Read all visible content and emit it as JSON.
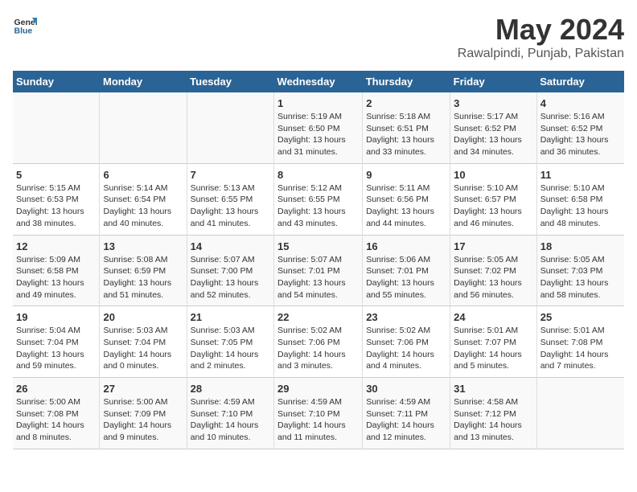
{
  "header": {
    "logo_general": "General",
    "logo_blue": "Blue",
    "title": "May 2024",
    "subtitle": "Rawalpindi, Punjab, Pakistan"
  },
  "days_of_week": [
    "Sunday",
    "Monday",
    "Tuesday",
    "Wednesday",
    "Thursday",
    "Friday",
    "Saturday"
  ],
  "weeks": [
    {
      "days": [
        {
          "num": "",
          "text": ""
        },
        {
          "num": "",
          "text": ""
        },
        {
          "num": "",
          "text": ""
        },
        {
          "num": "1",
          "text": "Sunrise: 5:19 AM\nSunset: 6:50 PM\nDaylight: 13 hours and 31 minutes."
        },
        {
          "num": "2",
          "text": "Sunrise: 5:18 AM\nSunset: 6:51 PM\nDaylight: 13 hours and 33 minutes."
        },
        {
          "num": "3",
          "text": "Sunrise: 5:17 AM\nSunset: 6:52 PM\nDaylight: 13 hours and 34 minutes."
        },
        {
          "num": "4",
          "text": "Sunrise: 5:16 AM\nSunset: 6:52 PM\nDaylight: 13 hours and 36 minutes."
        }
      ]
    },
    {
      "days": [
        {
          "num": "5",
          "text": "Sunrise: 5:15 AM\nSunset: 6:53 PM\nDaylight: 13 hours and 38 minutes."
        },
        {
          "num": "6",
          "text": "Sunrise: 5:14 AM\nSunset: 6:54 PM\nDaylight: 13 hours and 40 minutes."
        },
        {
          "num": "7",
          "text": "Sunrise: 5:13 AM\nSunset: 6:55 PM\nDaylight: 13 hours and 41 minutes."
        },
        {
          "num": "8",
          "text": "Sunrise: 5:12 AM\nSunset: 6:55 PM\nDaylight: 13 hours and 43 minutes."
        },
        {
          "num": "9",
          "text": "Sunrise: 5:11 AM\nSunset: 6:56 PM\nDaylight: 13 hours and 44 minutes."
        },
        {
          "num": "10",
          "text": "Sunrise: 5:10 AM\nSunset: 6:57 PM\nDaylight: 13 hours and 46 minutes."
        },
        {
          "num": "11",
          "text": "Sunrise: 5:10 AM\nSunset: 6:58 PM\nDaylight: 13 hours and 48 minutes."
        }
      ]
    },
    {
      "days": [
        {
          "num": "12",
          "text": "Sunrise: 5:09 AM\nSunset: 6:58 PM\nDaylight: 13 hours and 49 minutes."
        },
        {
          "num": "13",
          "text": "Sunrise: 5:08 AM\nSunset: 6:59 PM\nDaylight: 13 hours and 51 minutes."
        },
        {
          "num": "14",
          "text": "Sunrise: 5:07 AM\nSunset: 7:00 PM\nDaylight: 13 hours and 52 minutes."
        },
        {
          "num": "15",
          "text": "Sunrise: 5:07 AM\nSunset: 7:01 PM\nDaylight: 13 hours and 54 minutes."
        },
        {
          "num": "16",
          "text": "Sunrise: 5:06 AM\nSunset: 7:01 PM\nDaylight: 13 hours and 55 minutes."
        },
        {
          "num": "17",
          "text": "Sunrise: 5:05 AM\nSunset: 7:02 PM\nDaylight: 13 hours and 56 minutes."
        },
        {
          "num": "18",
          "text": "Sunrise: 5:05 AM\nSunset: 7:03 PM\nDaylight: 13 hours and 58 minutes."
        }
      ]
    },
    {
      "days": [
        {
          "num": "19",
          "text": "Sunrise: 5:04 AM\nSunset: 7:04 PM\nDaylight: 13 hours and 59 minutes."
        },
        {
          "num": "20",
          "text": "Sunrise: 5:03 AM\nSunset: 7:04 PM\nDaylight: 14 hours and 0 minutes."
        },
        {
          "num": "21",
          "text": "Sunrise: 5:03 AM\nSunset: 7:05 PM\nDaylight: 14 hours and 2 minutes."
        },
        {
          "num": "22",
          "text": "Sunrise: 5:02 AM\nSunset: 7:06 PM\nDaylight: 14 hours and 3 minutes."
        },
        {
          "num": "23",
          "text": "Sunrise: 5:02 AM\nSunset: 7:06 PM\nDaylight: 14 hours and 4 minutes."
        },
        {
          "num": "24",
          "text": "Sunrise: 5:01 AM\nSunset: 7:07 PM\nDaylight: 14 hours and 5 minutes."
        },
        {
          "num": "25",
          "text": "Sunrise: 5:01 AM\nSunset: 7:08 PM\nDaylight: 14 hours and 7 minutes."
        }
      ]
    },
    {
      "days": [
        {
          "num": "26",
          "text": "Sunrise: 5:00 AM\nSunset: 7:08 PM\nDaylight: 14 hours and 8 minutes."
        },
        {
          "num": "27",
          "text": "Sunrise: 5:00 AM\nSunset: 7:09 PM\nDaylight: 14 hours and 9 minutes."
        },
        {
          "num": "28",
          "text": "Sunrise: 4:59 AM\nSunset: 7:10 PM\nDaylight: 14 hours and 10 minutes."
        },
        {
          "num": "29",
          "text": "Sunrise: 4:59 AM\nSunset: 7:10 PM\nDaylight: 14 hours and 11 minutes."
        },
        {
          "num": "30",
          "text": "Sunrise: 4:59 AM\nSunset: 7:11 PM\nDaylight: 14 hours and 12 minutes."
        },
        {
          "num": "31",
          "text": "Sunrise: 4:58 AM\nSunset: 7:12 PM\nDaylight: 14 hours and 13 minutes."
        },
        {
          "num": "",
          "text": ""
        }
      ]
    }
  ]
}
